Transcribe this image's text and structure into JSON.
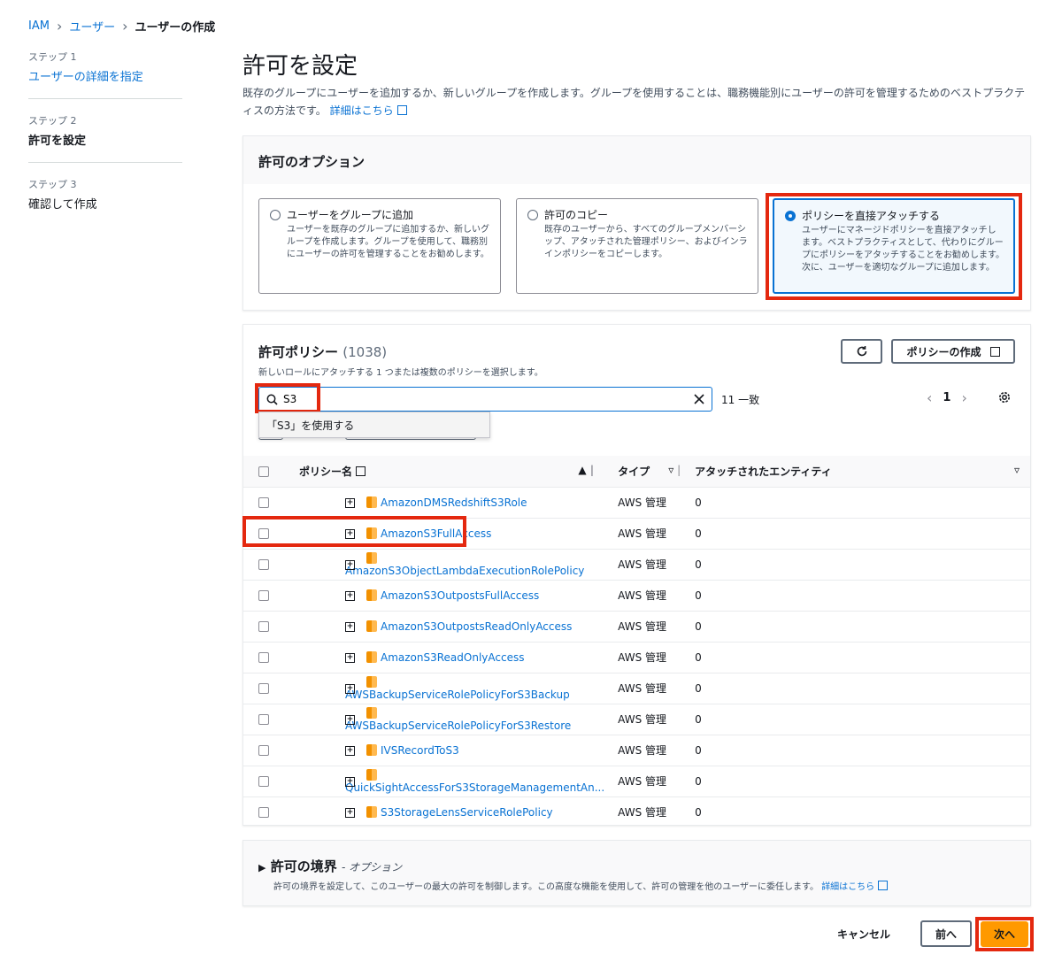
{
  "breadcrumb": {
    "items": [
      "IAM",
      "ユーザー",
      "ユーザーの作成"
    ]
  },
  "steps": [
    {
      "label": "ステップ 1",
      "name": "ユーザーの詳細を指定"
    },
    {
      "label": "ステップ 2",
      "name": "許可を設定"
    },
    {
      "label": "ステップ 3",
      "name": "確認して作成"
    }
  ],
  "page": {
    "title": "許可を設定",
    "description": "既存のグループにユーザーを追加するか、新しいグループを作成します。グループを使用することは、職務機能別にユーザーの許可を管理するためのベストプラクティスの方法です。",
    "learn_more": "詳細はこちら"
  },
  "options": {
    "title": "許可のオプション",
    "items": [
      {
        "title": "ユーザーをグループに追加",
        "desc": "ユーザーを既存のグループに追加するか、新しいグループを作成します。グループを使用して、職務別にユーザーの許可を管理することをお勧めします。"
      },
      {
        "title": "許可のコピー",
        "desc": "既存のユーザーから、すべてのグループメンバーシップ、アタッチされた管理ポリシー、およびインラインポリシーをコピーします。"
      },
      {
        "title": "ポリシーを直接アタッチする",
        "desc": "ユーザーにマネージドポリシーを直接アタッチします。ベストプラクティスとして、代わりにグループにポリシーをアタッチすることをお勧めします。次に、ユーザーを適切なグループに追加します。"
      }
    ],
    "selected": 2
  },
  "policies": {
    "title": "許可ポリシー",
    "count": "(1038)",
    "subtitle": "新しいロールにアタッチする 1 つまたは複数のポリシーを選択します。",
    "create_button": "ポリシーの作成",
    "search_value": "S3",
    "suggestion": "「S3」を使用する",
    "match_count": "11 一致",
    "page": "1",
    "columns": [
      "ポリシー名",
      "タイプ",
      "アタッチされたエンティティ"
    ],
    "rows": [
      {
        "name": "AmazonDMSRedshiftS3Role",
        "type": "AWS 管理",
        "entities": "0"
      },
      {
        "name": "AmazonS3FullAccess",
        "type": "AWS 管理",
        "entities": "0"
      },
      {
        "name": "AmazonS3ObjectLambdaExecutionRolePolicy",
        "type": "AWS 管理",
        "entities": "0"
      },
      {
        "name": "AmazonS3OutpostsFullAccess",
        "type": "AWS 管理",
        "entities": "0"
      },
      {
        "name": "AmazonS3OutpostsReadOnlyAccess",
        "type": "AWS 管理",
        "entities": "0"
      },
      {
        "name": "AmazonS3ReadOnlyAccess",
        "type": "AWS 管理",
        "entities": "0"
      },
      {
        "name": "AWSBackupServiceRolePolicyForS3Backup",
        "type": "AWS 管理",
        "entities": "0"
      },
      {
        "name": "AWSBackupServiceRolePolicyForS3Restore",
        "type": "AWS 管理",
        "entities": "0"
      },
      {
        "name": "IVSRecordToS3",
        "type": "AWS 管理",
        "entities": "0"
      },
      {
        "name": "QuickSightAccessForS3StorageManagementAn...",
        "type": "AWS 管理",
        "entities": "0"
      },
      {
        "name": "S3StorageLensServiceRolePolicy",
        "type": "AWS 管理",
        "entities": "0"
      }
    ]
  },
  "boundary": {
    "title": "許可の境界",
    "optional": "- オプション",
    "desc": "許可の境界を設定して、このユーザーの最大の許可を制御します。この高度な機能を使用して、許可の管理を他のユーザーに委任します。",
    "learn_more": "詳細はこちら"
  },
  "footer": {
    "cancel": "キャンセル",
    "prev": "前へ",
    "next": "次へ"
  },
  "colors": {
    "link": "#0972d3",
    "primary": "#ff9900",
    "highlight": "#e4280f"
  }
}
